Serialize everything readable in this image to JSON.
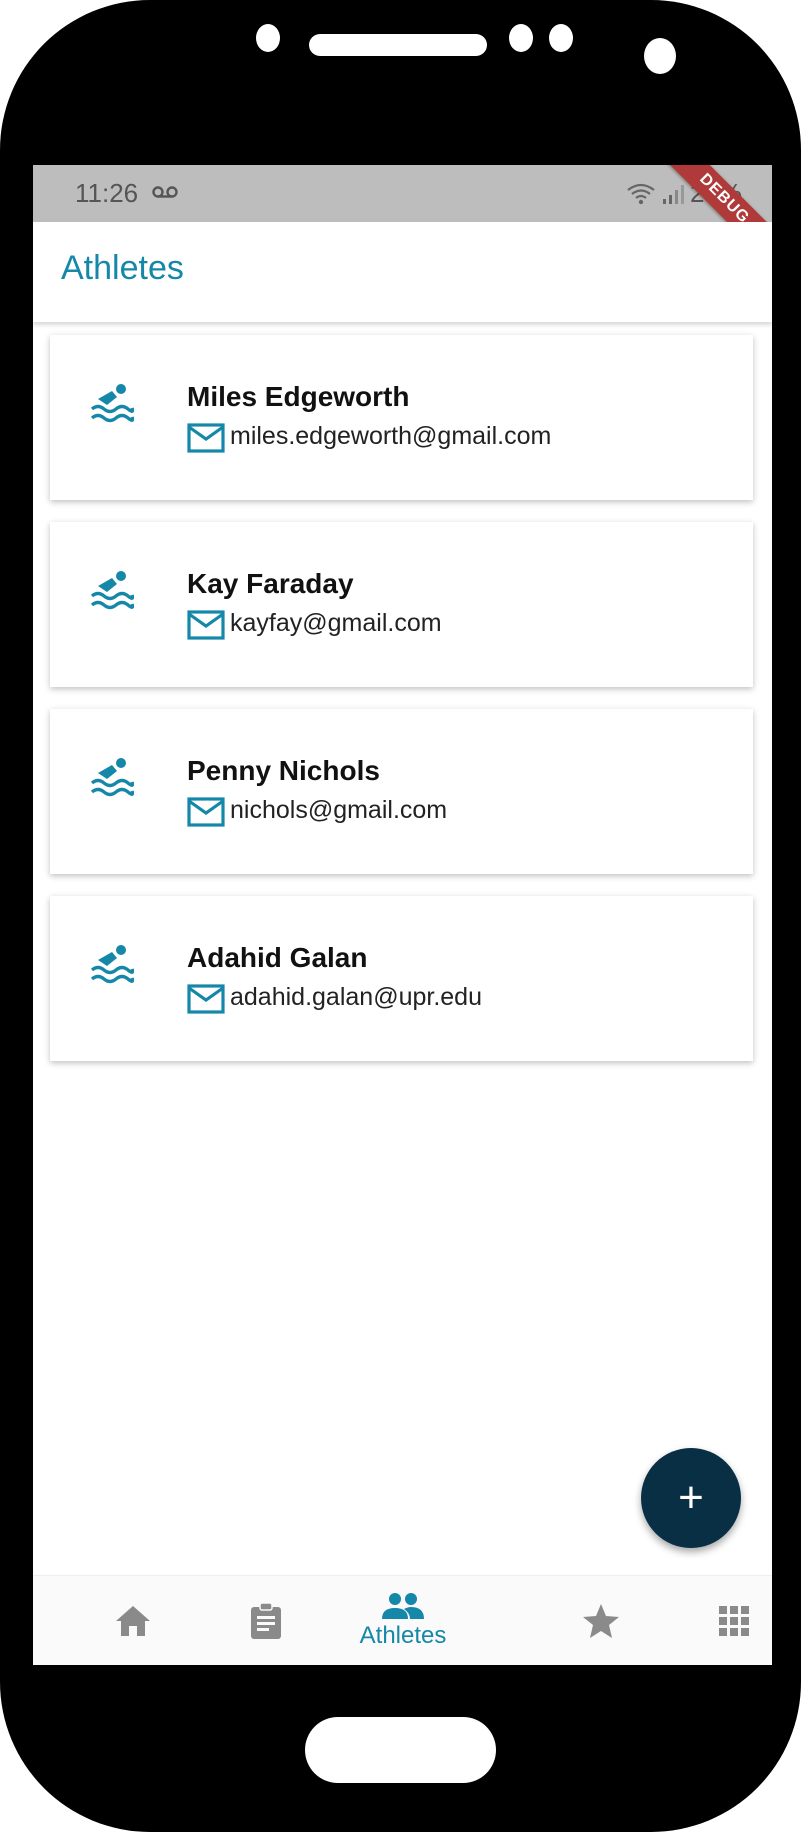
{
  "status_bar": {
    "time": "11:26",
    "battery": "29%"
  },
  "debug_banner": "DEBUG",
  "app_bar": {
    "title": "Athletes"
  },
  "athletes": [
    {
      "name": "Miles Edgeworth",
      "email": "miles.edgeworth@gmail.com",
      "icon": "swimming-icon"
    },
    {
      "name": "Kay Faraday",
      "email": "kayfay@gmail.com",
      "icon": "swimming-icon"
    },
    {
      "name": "Penny Nichols",
      "email": "nichols@gmail.com",
      "icon": "swimming-icon"
    },
    {
      "name": "Adahid Galan",
      "email": "adahid.galan@upr.edu",
      "icon": "swimming-icon"
    }
  ],
  "fab": {
    "icon": "plus-icon",
    "glyph": "+"
  },
  "bottom_nav": {
    "items": [
      {
        "icon": "home-icon",
        "label": ""
      },
      {
        "icon": "clipboard-icon",
        "label": ""
      },
      {
        "icon": "people-icon",
        "label": "Athletes",
        "active": true
      },
      {
        "icon": "star-icon",
        "label": ""
      },
      {
        "icon": "apps-grid-icon",
        "label": ""
      }
    ]
  },
  "colors": {
    "accent": "#1587a8",
    "fab": "#082f44",
    "inactive_icon": "#8a8a8a"
  }
}
